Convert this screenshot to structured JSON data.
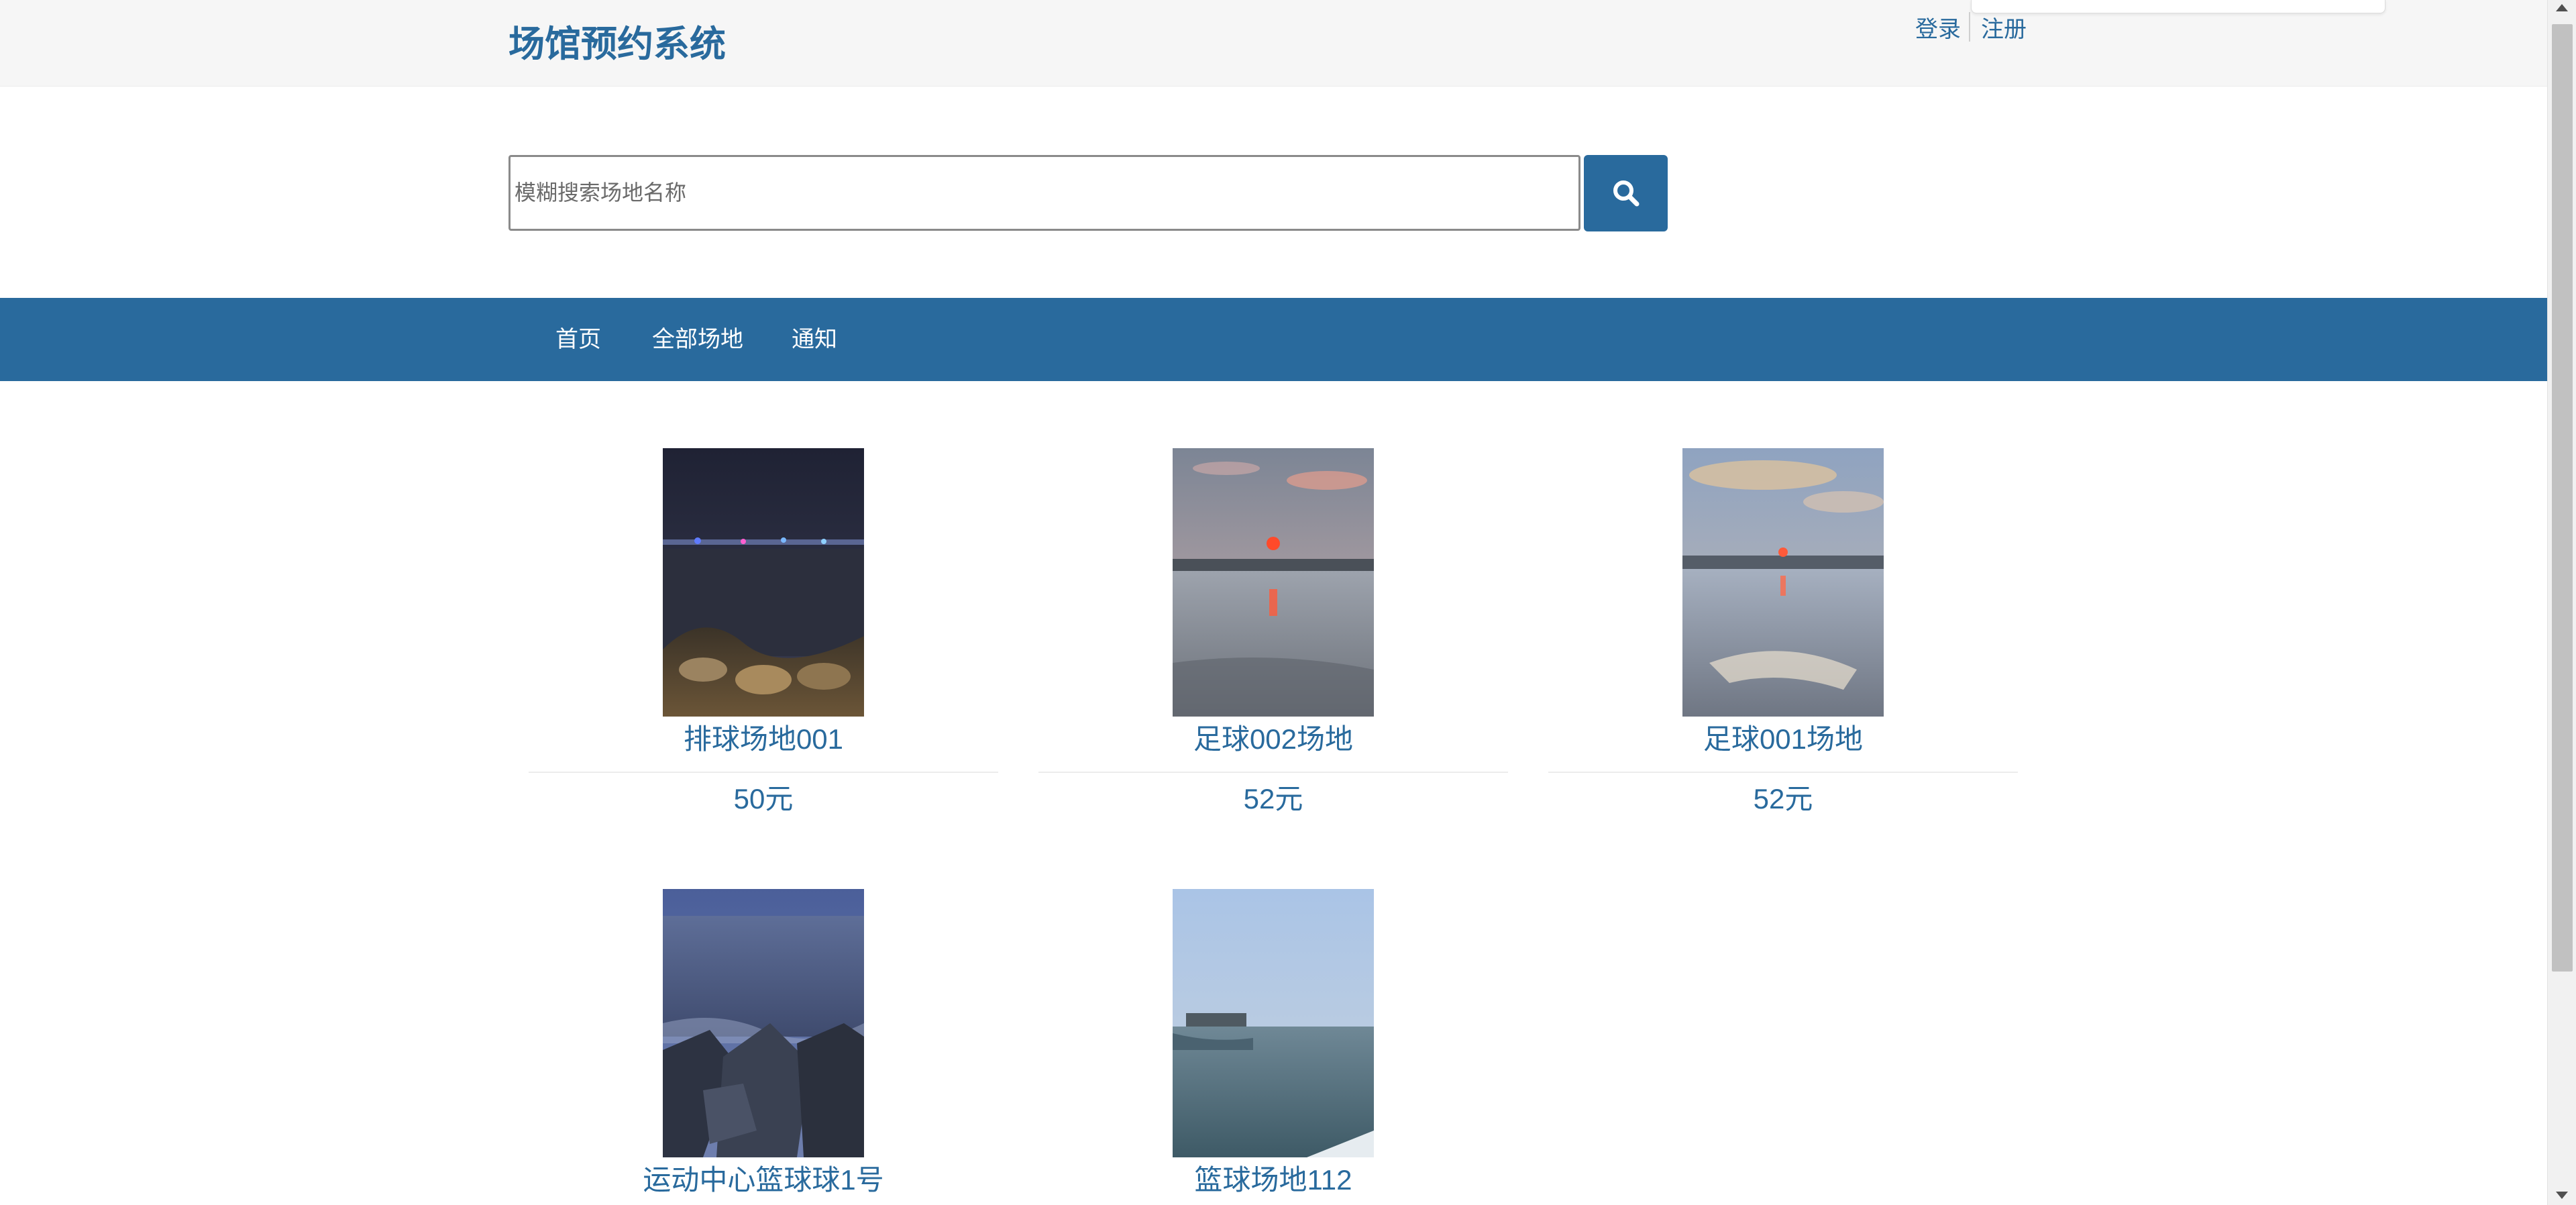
{
  "header": {
    "title": "场馆预约系统",
    "login_label": "登录",
    "register_label": "注册"
  },
  "search": {
    "placeholder": "模糊搜索场地名称",
    "value": "",
    "button_icon": "search-icon"
  },
  "nav": {
    "items": [
      {
        "label": "首页"
      },
      {
        "label": "全部场地"
      },
      {
        "label": "通知"
      }
    ]
  },
  "venues": [
    {
      "name": "排球场地001",
      "price": "50元",
      "image": "night-seashore-photo"
    },
    {
      "name": "足球002场地",
      "price": "52元",
      "image": "sunset-tidal-flat-photo"
    },
    {
      "name": "足球001场地",
      "price": "52元",
      "image": "dusk-tidal-flat-photo"
    },
    {
      "name": "运动中心篮球球1号",
      "price": "",
      "image": "breakwater-sea-photo"
    },
    {
      "name": "篮球场地112",
      "price": "",
      "image": "calm-bay-photo"
    }
  ],
  "colors": {
    "brand": "#296a9d",
    "header_bg": "#f6f6f6",
    "nav_text": "#ffffff"
  }
}
